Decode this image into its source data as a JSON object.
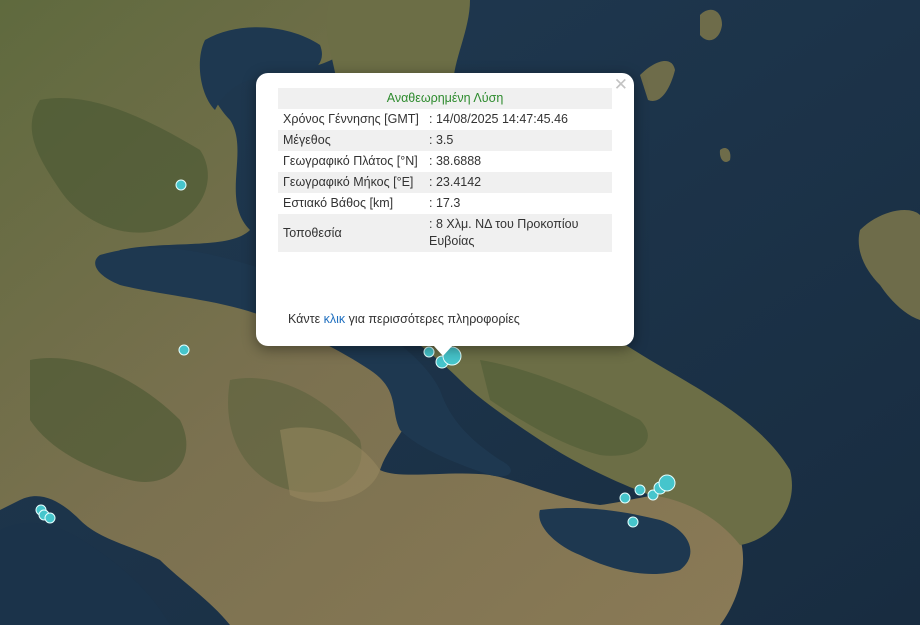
{
  "popup": {
    "header": "Αναθεωρημένη Λύση",
    "close_icon": "close-icon",
    "rows": [
      {
        "label": "Χρόνος Γέννησης [GMT]",
        "value": ": 14/08/2025 14:47:45.46"
      },
      {
        "label": "Μέγεθος",
        "value": ": 3.5"
      },
      {
        "label": "Γεωγραφικό Πλάτος [°N]",
        "value": ": 38.6888"
      },
      {
        "label": "Γεωγραφικό Μήκος [°E]",
        "value": ": 23.4142"
      },
      {
        "label": "Εστιακό Βάθος [km]",
        "value": ": 17.3"
      },
      {
        "label": "Τοποθεσία",
        "value": ": 8 Χλμ. ΝΔ του Προκοπίου Ευβοίας"
      }
    ],
    "footer": {
      "before": "Κάντε ",
      "link": "κλικ",
      "after": " για περισσότερες πληροφορίες"
    }
  },
  "colors": {
    "sea": "#1d3449",
    "land": "#6b6a48",
    "marker_fill": "#46c5cc",
    "marker_stroke": "#e6ffff",
    "header_text": "#2e8b2e",
    "link": "#1f6fbf"
  },
  "map": {
    "marker_icon": "earthquake-marker-icon",
    "selected_marker_icon": "selected-earthquake-marker-icon"
  }
}
